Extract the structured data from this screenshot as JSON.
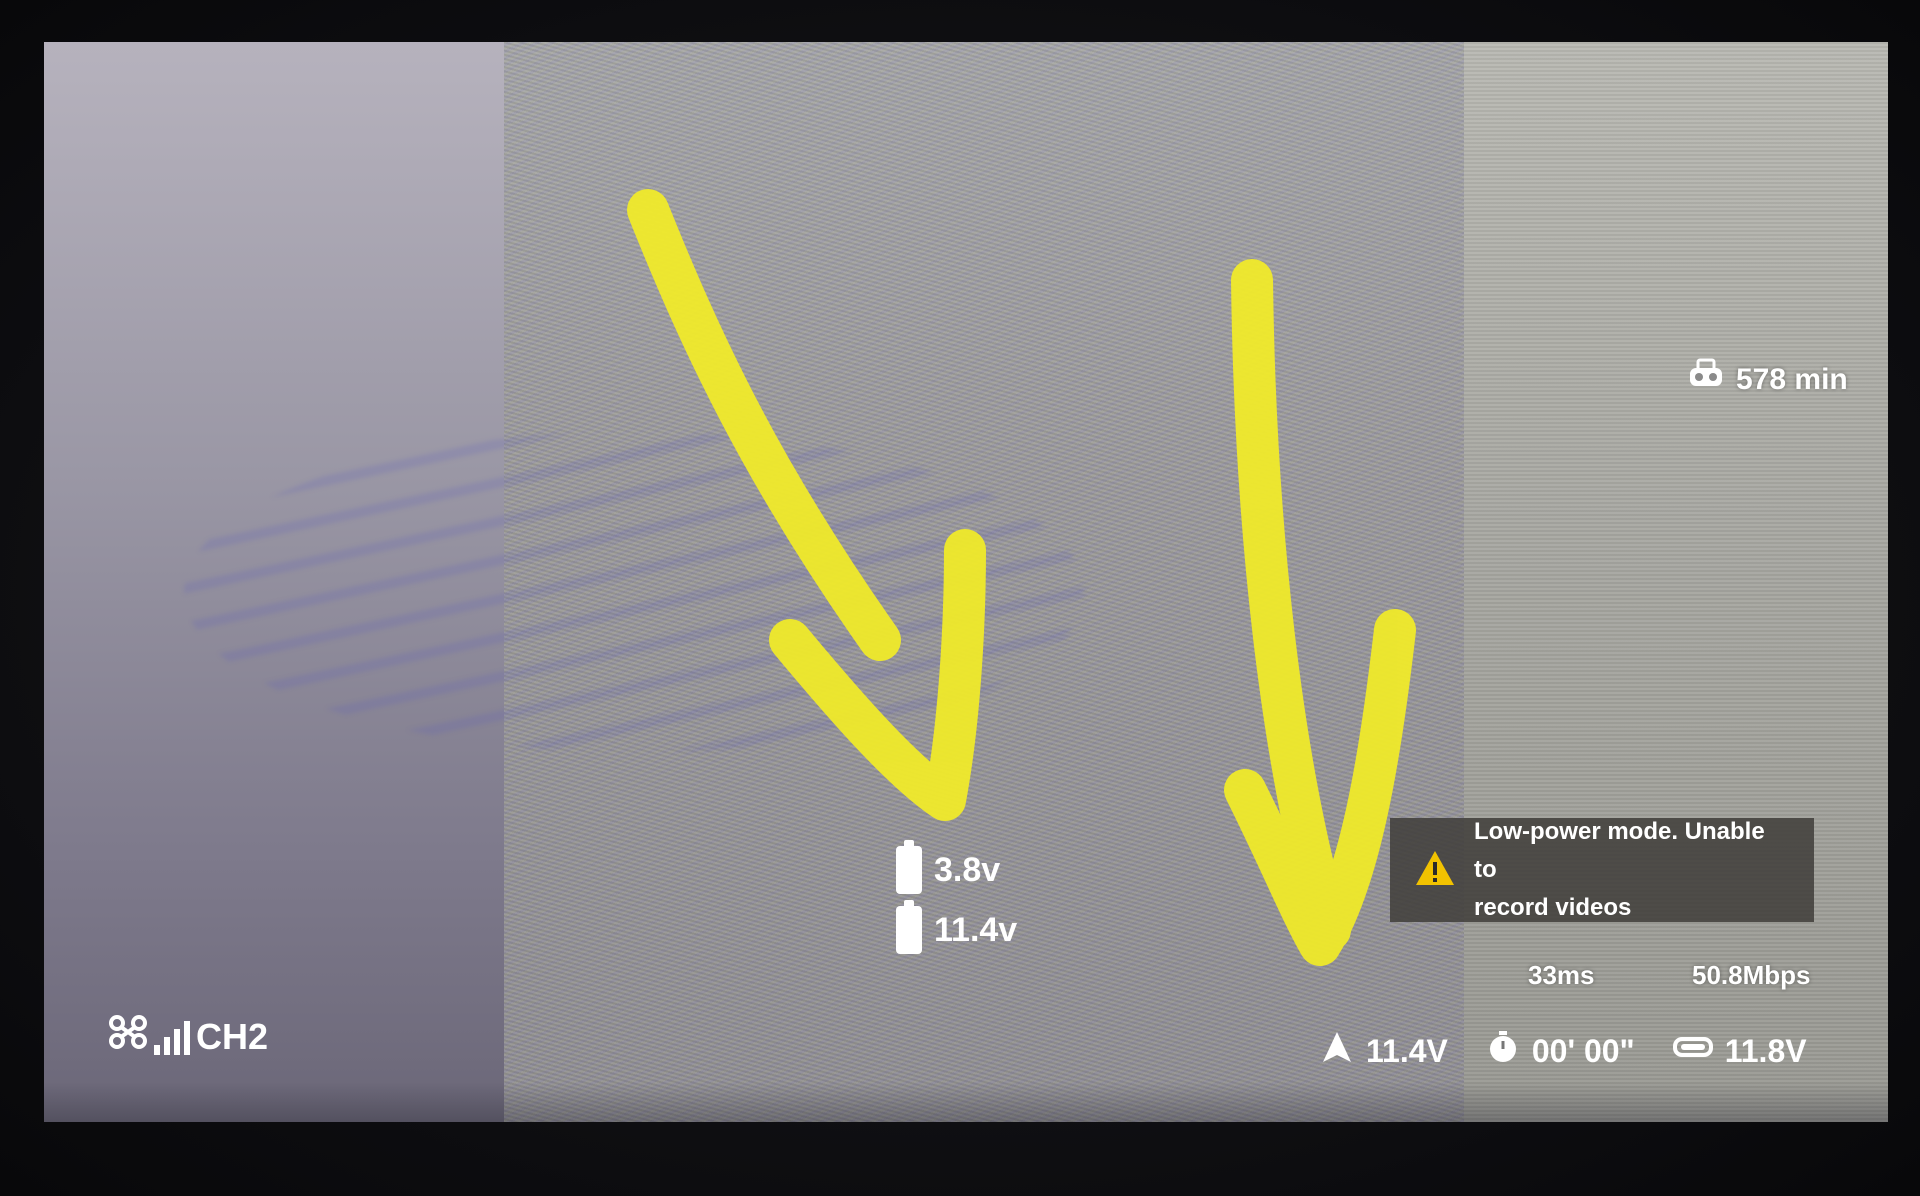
{
  "storage": {
    "icon": "goggles-storage-icon",
    "value": "578 min"
  },
  "batteries": [
    {
      "icon": "battery-icon",
      "value": "3.8v"
    },
    {
      "icon": "battery-icon",
      "value": "11.4v"
    }
  ],
  "notification": {
    "icon": "warning-icon",
    "line1": "Low-power mode. Unable to",
    "line2": "record videos",
    "color": "#f2c200"
  },
  "link": {
    "latency": "33ms",
    "bitrate": "50.8Mbps"
  },
  "signal": {
    "drone_icon": "drone-icon",
    "bars": 4,
    "channel": "CH2"
  },
  "status_bar": {
    "aircraft_voltage": "11.4V",
    "flight_time": "00' 00\"",
    "goggles_voltage": "11.8V"
  },
  "annotation_color": "#f0ea2a"
}
